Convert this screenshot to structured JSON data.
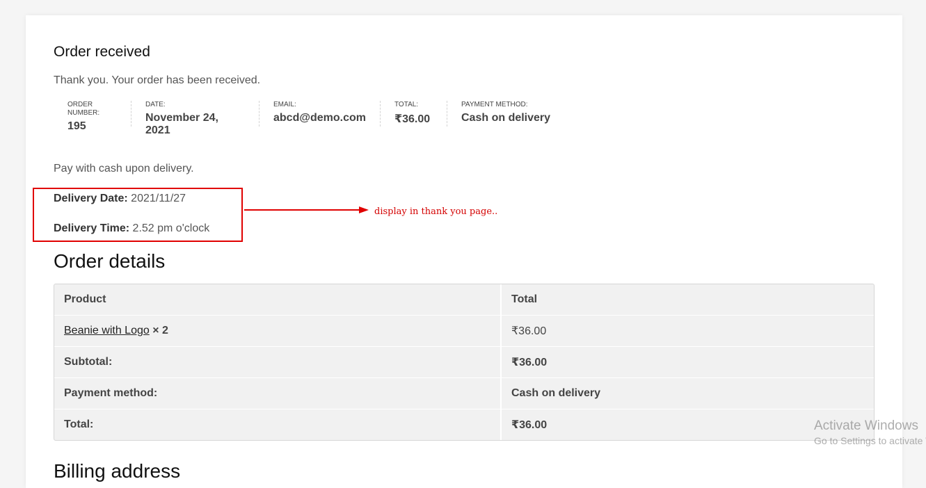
{
  "order_received": {
    "title": "Order received",
    "thanks": "Thank you. Your order has been received."
  },
  "overview": [
    {
      "label": "ORDER NUMBER:",
      "value": "195"
    },
    {
      "label": "DATE:",
      "value": "November 24, 2021"
    },
    {
      "label": "EMAIL:",
      "value": "abcd@demo.com"
    },
    {
      "label": "TOTAL:",
      "value": "₹36.00"
    },
    {
      "label": "PAYMENT METHOD:",
      "value": "Cash on delivery"
    }
  ],
  "payment_note": "Pay with cash upon delivery.",
  "delivery": {
    "date_label": "Delivery Date:",
    "date_value": "2021/11/27",
    "time_label": "Delivery Time:",
    "time_value": "2.52 pm o'clock"
  },
  "annotation": {
    "text": "display in thank you page..",
    "color": "#e00000"
  },
  "order_details": {
    "title": "Order details",
    "headers": {
      "product": "Product",
      "total": "Total"
    },
    "item": {
      "name": "Beanie with Logo",
      "qty": "× 2",
      "total": "₹36.00"
    },
    "rows": [
      {
        "label": "Subtotal:",
        "value": "₹36.00"
      },
      {
        "label": "Payment method:",
        "value": "Cash on delivery"
      },
      {
        "label": "Total:",
        "value": "₹36.00"
      }
    ]
  },
  "billing_title": "Billing address",
  "watermark": {
    "title": "Activate Windows",
    "subtitle": "Go to Settings to activate Windows."
  }
}
